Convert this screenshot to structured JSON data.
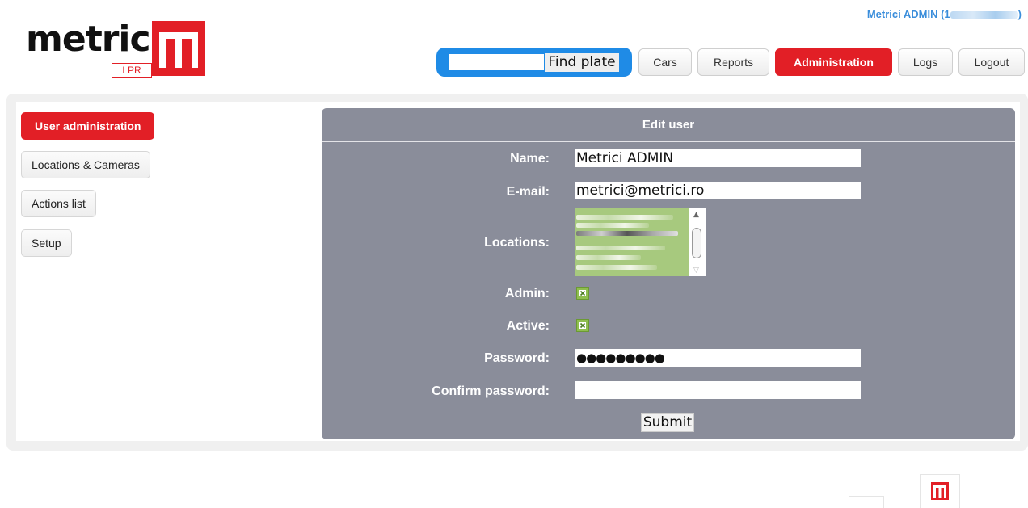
{
  "brand": {
    "name": "metricí",
    "sub": "LPR",
    "color": "#e21f26"
  },
  "header": {
    "user_label": "Metrici ADMIN (1",
    "user_suffix": ")",
    "find_plate": {
      "button_label": "Find plate",
      "value": ""
    },
    "nav": [
      {
        "label": "Cars"
      },
      {
        "label": "Reports"
      },
      {
        "label": "Administration",
        "active": true
      },
      {
        "label": "Logs"
      },
      {
        "label": "Logout"
      }
    ]
  },
  "sidebar": {
    "items": [
      {
        "label": "User administration",
        "active": true
      },
      {
        "label": "Locations & Cameras"
      },
      {
        "label": "Actions list"
      },
      {
        "label": "Setup"
      }
    ]
  },
  "form": {
    "title": "Edit user",
    "labels": {
      "name": "Name:",
      "email": "E-mail:",
      "locations": "Locations:",
      "admin": "Admin:",
      "active": "Active:",
      "password": "Password:",
      "confirm_password": "Confirm password:"
    },
    "values": {
      "name": "Metrici ADMIN",
      "email": "metrici@metrici.ro",
      "password": "●●●●●●●●●",
      "confirm_password": "",
      "admin_checked": true,
      "active_checked": true
    },
    "submit_label": "Submit"
  },
  "colors": {
    "accent": "#e21f26",
    "nav_blue": "#1f8be6",
    "form_bg": "#8a8d9a",
    "user_link": "#3b8edb",
    "location_selected": "#a7c97e"
  },
  "icons": {
    "brand_mark": "metrici-m-logo-icon",
    "checkbox": "checkbox-checked-icon",
    "scroll_up": "scroll-up-arrow-icon",
    "scroll_down": "scroll-down-arrow-icon"
  }
}
